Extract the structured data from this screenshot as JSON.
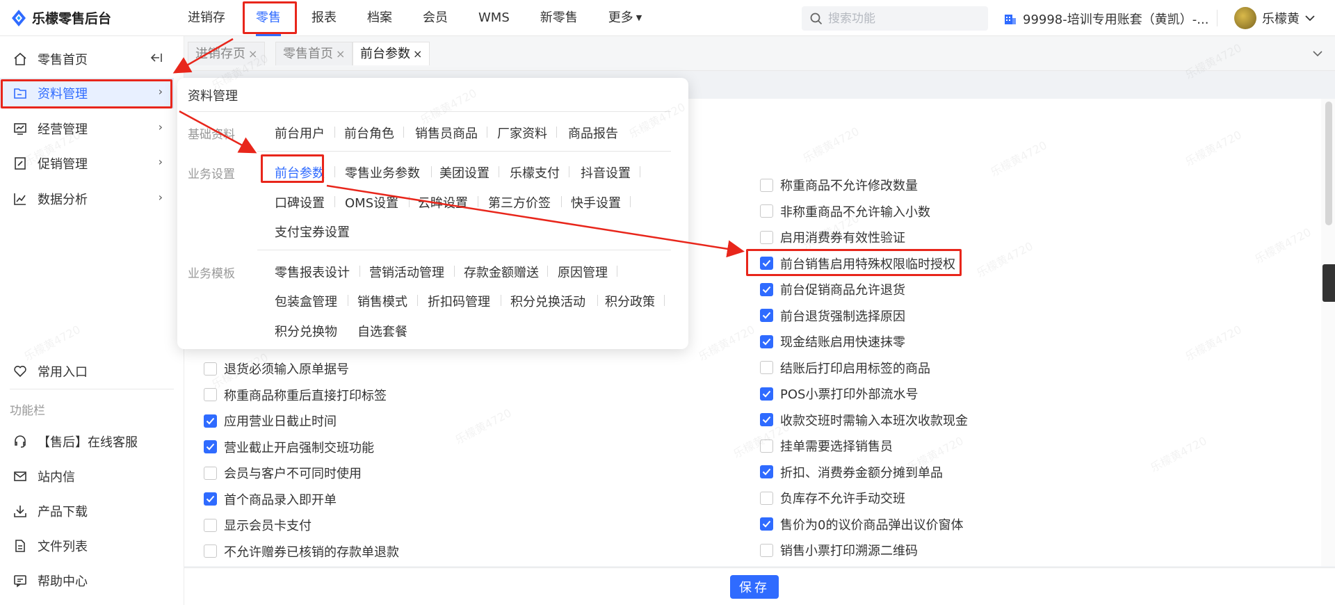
{
  "app": {
    "title": "乐檬零售后台"
  },
  "topnav": [
    {
      "label": "进销存",
      "active": false
    },
    {
      "label": "零售",
      "active": true
    },
    {
      "label": "报表",
      "active": false
    },
    {
      "label": "档案",
      "active": false
    },
    {
      "label": "会员",
      "active": false
    },
    {
      "label": "WMS",
      "active": false
    },
    {
      "label": "新零售",
      "active": false
    },
    {
      "label": "更多",
      "active": false
    }
  ],
  "search": {
    "placeholder": "搜索功能"
  },
  "account": {
    "label": "99998-培训专用账套（黄凯）-..."
  },
  "user": {
    "name": "乐檬黄"
  },
  "sidebar": {
    "items": [
      {
        "label": "零售首页",
        "icon": "home-icon"
      },
      {
        "label": "资料管理",
        "icon": "folder-icon"
      },
      {
        "label": "经营管理",
        "icon": "trend-icon"
      },
      {
        "label": "促销管理",
        "icon": "promo-icon"
      },
      {
        "label": "数据分析",
        "icon": "chart-icon"
      }
    ],
    "common_entry": "常用入口",
    "section_label": "功能栏",
    "functions": [
      {
        "label": "【售后】在线客服",
        "icon": "headset-icon"
      },
      {
        "label": "站内信",
        "icon": "mail-icon"
      },
      {
        "label": "产品下载",
        "icon": "download-icon"
      },
      {
        "label": "文件列表",
        "icon": "file-icon"
      },
      {
        "label": "帮助中心",
        "icon": "help-icon"
      }
    ]
  },
  "tabs": [
    {
      "label": "进销存页",
      "active": false
    },
    {
      "label": "零售首页",
      "active": false
    },
    {
      "label": "前台参数",
      "active": true
    }
  ],
  "panel": {
    "title": "资料管理",
    "groups": [
      {
        "label": "基础资料",
        "links": [
          "前台用户",
          "前台角色",
          "销售员商品",
          "厂家资料",
          "商品报告"
        ]
      },
      {
        "label": "业务设置",
        "links": [
          "前台参数",
          "零售业务参数",
          "美团设置",
          "乐檬支付",
          "抖音设置",
          "口碑设置",
          "OMS设置",
          "云眸设置",
          "第三方价签",
          "快手设置",
          "支付宝券设置"
        ]
      },
      {
        "label": "业务模板",
        "links": [
          "零售报表设计",
          "营销活动管理",
          "存款金额赠送",
          "原因管理",
          "包装盒管理",
          "销售模式",
          "折扣码管理",
          "积分兑换活动",
          "积分政策",
          "积分兑换物",
          "自选套餐"
        ]
      }
    ]
  },
  "left_options": [
    {
      "label": "退货必须输入原单据号",
      "checked": false
    },
    {
      "label": "称重商品称重后直接打印标签",
      "checked": false
    },
    {
      "label": "应用营业日截止时间",
      "checked": true
    },
    {
      "label": "营业截止开启强制交班功能",
      "checked": true
    },
    {
      "label": "会员与客户不可同时使用",
      "checked": false
    },
    {
      "label": "首个商品录入即开单",
      "checked": true
    },
    {
      "label": "显示会员卡支付",
      "checked": false
    },
    {
      "label": "不允许赠券已核销的存款单退款",
      "checked": false
    }
  ],
  "right_options": [
    {
      "label": "称重商品不允许修改数量",
      "checked": false
    },
    {
      "label": "非称重商品不允许输入小数",
      "checked": false
    },
    {
      "label": "启用消费券有效性验证",
      "checked": false
    },
    {
      "label": "前台销售启用特殊权限临时授权",
      "checked": true
    },
    {
      "label": "前台促销商品允许退货",
      "checked": true
    },
    {
      "label": "前台退货强制选择原因",
      "checked": true
    },
    {
      "label": "现金结账启用快速抹零",
      "checked": true
    },
    {
      "label": "结账后打印启用标签的商品",
      "checked": false
    },
    {
      "label": "POS小票打印外部流水号",
      "checked": true
    },
    {
      "label": "收款交班时需输入本班次收款现金",
      "checked": true
    },
    {
      "label": "挂单需要选择销售员",
      "checked": false
    },
    {
      "label": "折扣、消费券金额分摊到单品",
      "checked": true
    },
    {
      "label": "负库存不允许手动交班",
      "checked": false
    },
    {
      "label": "售价为0的议价商品弹出议价窗体",
      "checked": true
    },
    {
      "label": "销售小票打印溯源二维码",
      "checked": false
    }
  ],
  "footer": {
    "save_label": "保存"
  },
  "watermark": "乐檬黄4720",
  "colors": {
    "accent": "#2f6bff",
    "annotation": "#e8261b"
  }
}
